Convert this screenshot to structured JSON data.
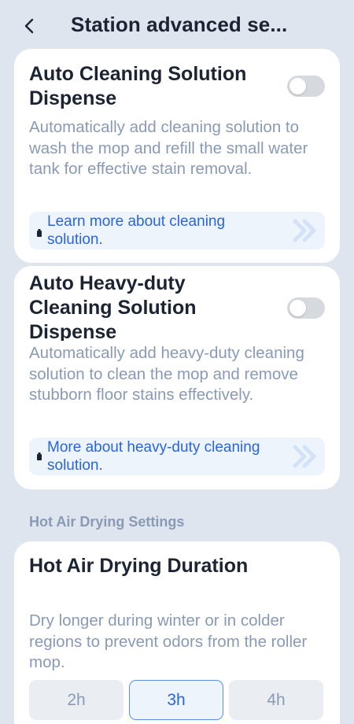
{
  "header": {
    "title": "Station advanced se...",
    "back_icon": "chevron-left-icon"
  },
  "cards": {
    "auto_dispense": {
      "title": "Auto Cleaning Solution Dispense",
      "toggle_on": false,
      "description": "Automatically add cleaning solution to wash the mop and refill the small water tank for effective stain removal.",
      "link_text": "Learn more about cleaning solution.",
      "link_icon": "bottle-icon",
      "link_arrow_icon": "double-chevron-right-icon"
    },
    "heavy_duty": {
      "title": "Auto Heavy-duty Cleaning Solution Dispense",
      "toggle_on": false,
      "description": "Automatically add heavy-duty cleaning solution to clean the mop and remove stubborn floor stains effectively.",
      "link_text": "More about heavy-duty cleaning solution.",
      "link_icon": "bottle-icon",
      "link_arrow_icon": "double-chevron-right-icon"
    }
  },
  "sections": {
    "hot_air": {
      "label": "Hot Air Drying Settings",
      "card": {
        "title": "Hot Air Drying Duration",
        "description": "Dry longer during winter or in colder regions to prevent odors from the roller mop.",
        "options": [
          "2h",
          "3h",
          "4h"
        ],
        "selected": "3h"
      }
    }
  },
  "colors": {
    "background": "#dfe5ee",
    "accent": "#2a64e0",
    "muted_text": "#8a9ab5",
    "toggle_off": "#d6d9de"
  }
}
